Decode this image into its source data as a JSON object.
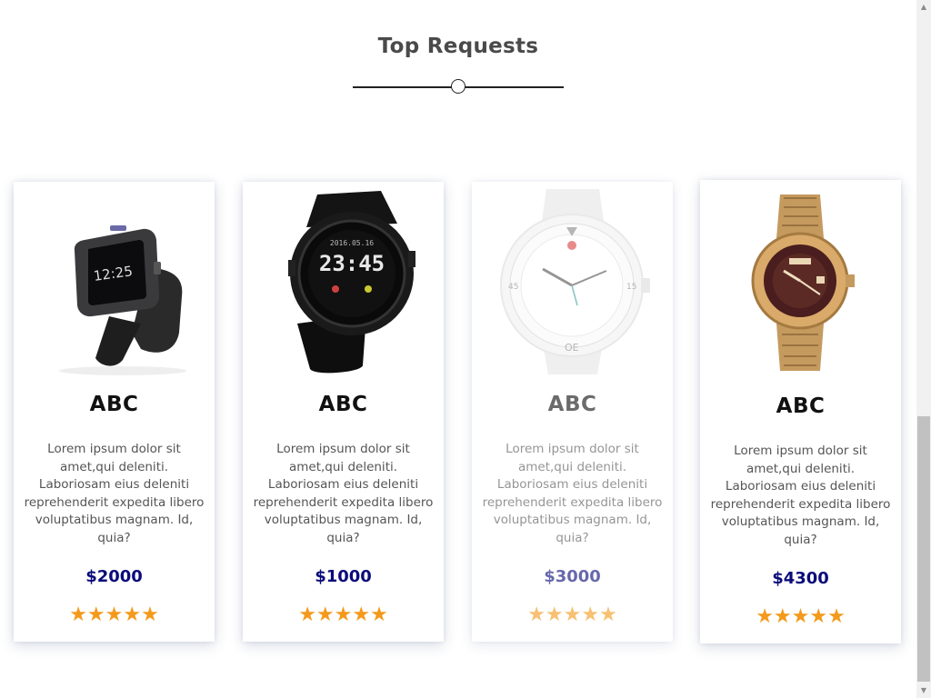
{
  "section": {
    "title": "Top Requests"
  },
  "products": [
    {
      "name": "ABC",
      "description": "Lorem ipsum dolor sit amet,qui deleniti. Laboriosam eius deleniti reprehenderit expedita libero voluptatibus magnam. Id, quia?",
      "price": "$2000",
      "rating": 5,
      "stars": "★★★★★",
      "image_icon": "smartwatch-icon"
    },
    {
      "name": "ABC",
      "description": "Lorem ipsum dolor sit amet,qui deleniti. Laboriosam eius deleniti reprehenderit expedita libero voluptatibus magnam. Id, quia?",
      "price": "$1000",
      "rating": 5,
      "stars": "★★★★★",
      "image_icon": "digital-sport-watch-icon"
    },
    {
      "name": "ABC",
      "description": "Lorem ipsum dolor sit amet,qui deleniti. Laboriosam eius deleniti reprehenderit expedita libero voluptatibus magnam. Id, quia?",
      "price": "$3000",
      "rating": 5,
      "stars": "★★★★★",
      "image_icon": "white-dive-watch-icon"
    },
    {
      "name": "ABC",
      "description": "Lorem ipsum dolor sit amet,qui deleniti. Laboriosam eius deleniti reprehenderit expedita libero voluptatibus magnam. Id, quia?",
      "price": "$4300",
      "rating": 5,
      "stars": "★★★★★",
      "image_icon": "gold-wristwatch-icon"
    }
  ],
  "watch_faces": {
    "digital_time": "23:45",
    "digital_date": "2016.05.16",
    "smartwatch_time": "12:25",
    "dial_numbers": [
      "15",
      "45",
      "OE"
    ]
  },
  "colors": {
    "title": "#4a4a4a",
    "price": "#0b0b7a",
    "star": "#f39a1c",
    "text": "#555555"
  }
}
